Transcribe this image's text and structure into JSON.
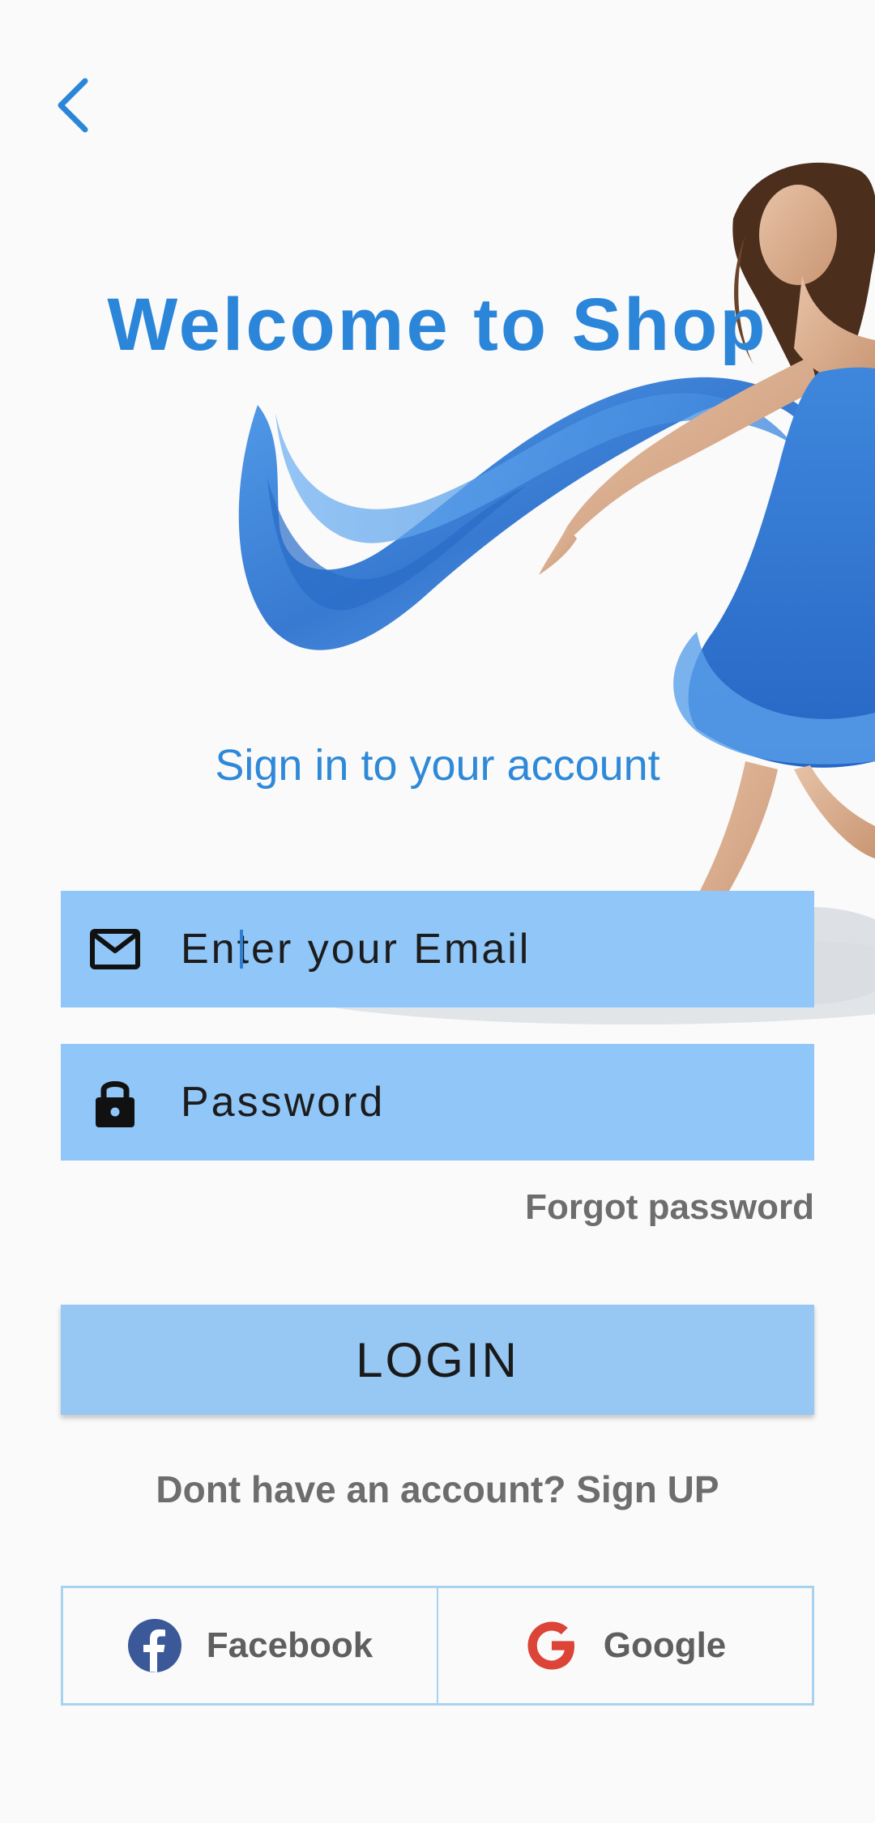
{
  "header": {
    "back_icon": "chevron-left-icon"
  },
  "hero": {
    "title": "Welcome to Shop",
    "subtitle": "Sign in to your account"
  },
  "form": {
    "email_placeholder": "Enter your Email",
    "email_icon": "mail-icon",
    "password_placeholder": "Password",
    "password_icon": "lock-icon",
    "forgot_label": "Forgot password",
    "login_label": "LOGIN",
    "signup_label": "Dont have an account? Sign UP"
  },
  "social": {
    "facebook_label": "Facebook",
    "google_label": "Google"
  },
  "colors": {
    "accent": "#2b86d9",
    "field_bg": "#90c6f8",
    "button_bg": "#97c8f4",
    "muted_text": "#6d6d6d",
    "facebook": "#3b5998",
    "google": "#db4437"
  }
}
